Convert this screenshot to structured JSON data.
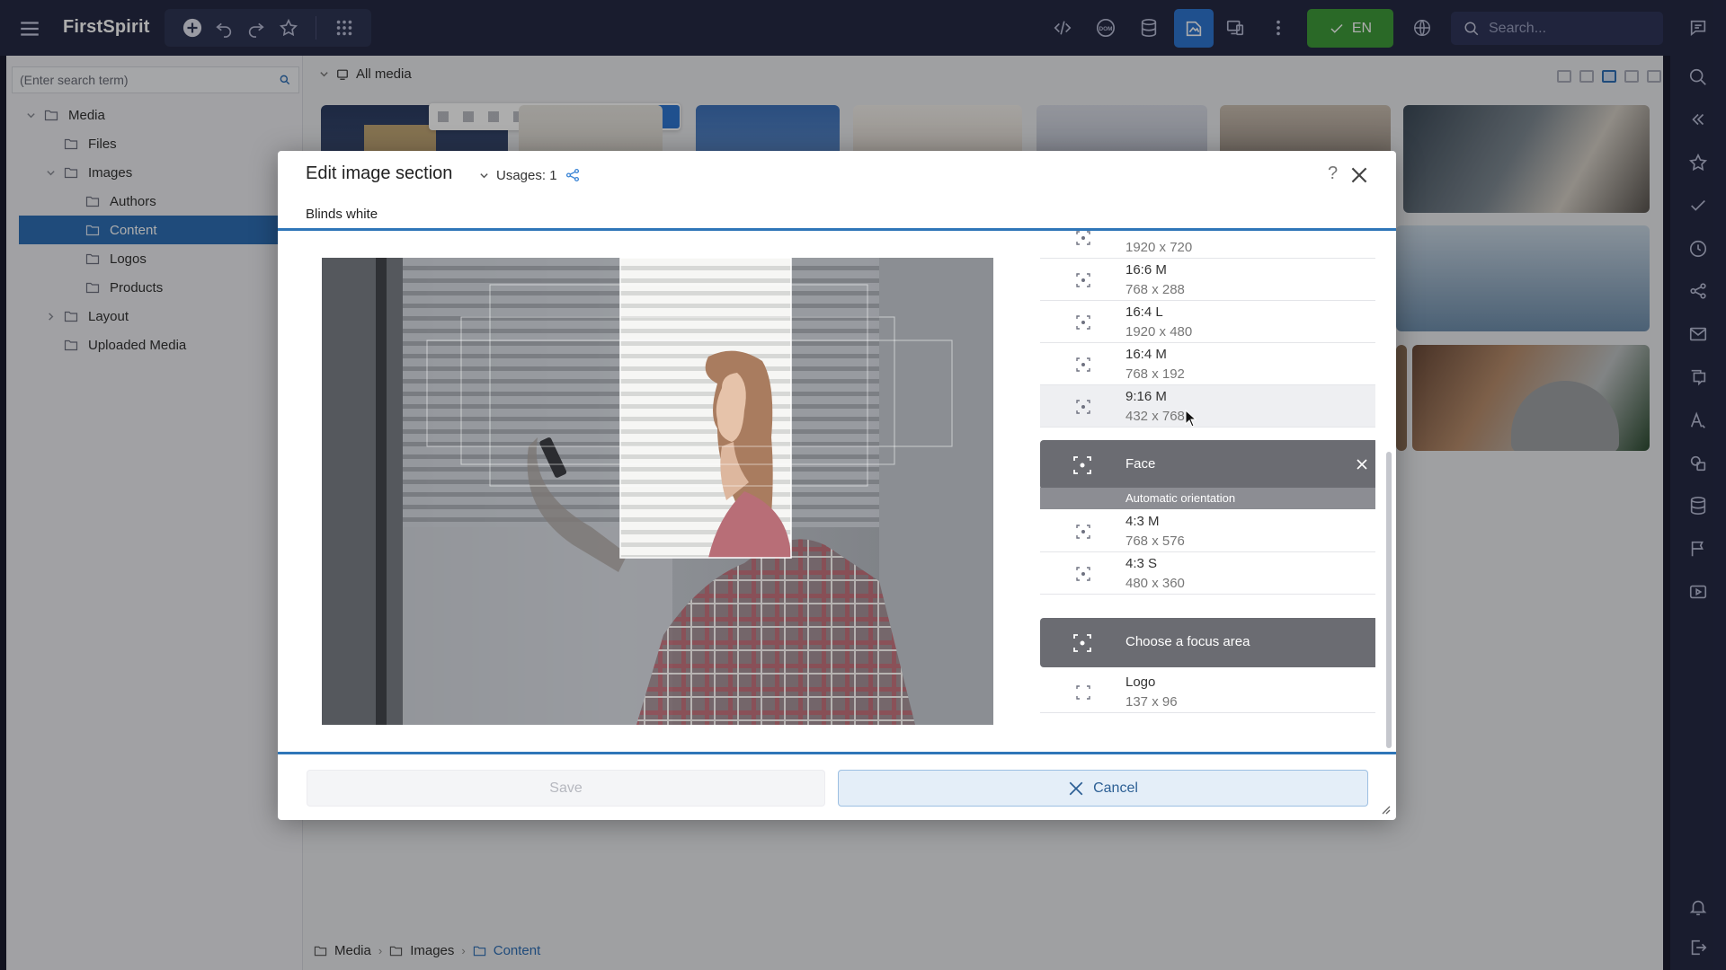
{
  "app": {
    "title": "FirstSpirit",
    "language_button": "EN",
    "search_placeholder": "Search..."
  },
  "tree": {
    "search_placeholder": "(Enter search term)",
    "items": [
      {
        "label": "Media"
      },
      {
        "label": "Files"
      },
      {
        "label": "Images"
      },
      {
        "label": "Authors"
      },
      {
        "label": "Content"
      },
      {
        "label": "Logos"
      },
      {
        "label": "Products"
      },
      {
        "label": "Layout"
      },
      {
        "label": "Uploaded Media"
      }
    ]
  },
  "content": {
    "header": "All media",
    "breadcrumb": [
      "Media",
      "Images",
      "Content"
    ]
  },
  "modal": {
    "title": "Edit image section",
    "usages": "Usages: 1",
    "help": "?",
    "image_name": "Blinds white",
    "rows_top": [
      {
        "name": "",
        "dims": "1920 x 720"
      },
      {
        "name": "16:6 M",
        "dims": "768 x 288"
      },
      {
        "name": "16:4 L",
        "dims": "1920 x 480"
      },
      {
        "name": "16:4 M",
        "dims": "768 x 192"
      },
      {
        "name": "9:16 M",
        "dims": "432 x 768"
      }
    ],
    "group_face": {
      "label": "Face",
      "orientation": "Automatic orientation",
      "rows": [
        {
          "name": "4:3 M",
          "dims": "768 x 576"
        },
        {
          "name": "4:3 S",
          "dims": "480 x 360"
        }
      ]
    },
    "group_focus": {
      "label": "Choose a focus area",
      "rows": [
        {
          "name": "Logo",
          "dims": "137 x 96"
        }
      ]
    },
    "save_label": "Save",
    "cancel_label": "Cancel"
  },
  "colors": {
    "topbar": "#252a45",
    "accent": "#2f76d2",
    "language_button": "#3f9b3a",
    "selection": "#2f6fb6",
    "group_header": "#6b6c72"
  }
}
